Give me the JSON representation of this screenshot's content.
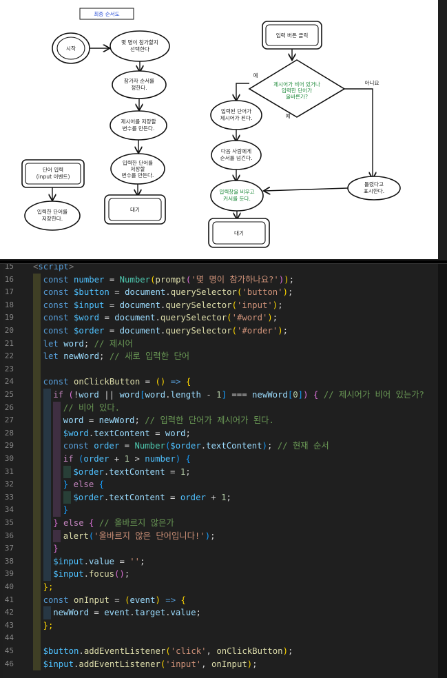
{
  "flowchart": {
    "title": "최종 순서도",
    "left": {
      "start": "시작",
      "n1": [
        "몇 명이 참가할지",
        "선택한다"
      ],
      "n2": [
        "참가자 순서를",
        "정한다."
      ],
      "n3": [
        "제시어를 저장할",
        "변수를 만든다."
      ],
      "n4": [
        "입력한 단어를",
        "저장할",
        "변수를 만든다."
      ],
      "wait": "대기",
      "event": [
        "단어 입력",
        "(input 이벤트)"
      ],
      "store": [
        "입력한 단어를",
        "저장한다."
      ]
    },
    "right": {
      "click": "입력 버튼 클릭",
      "decision": [
        "제시어가 비어 있거나",
        "입력한 단어가",
        "올바른가?"
      ],
      "yes1": "예",
      "yes2": "예",
      "no": "아니요",
      "r1": [
        "입력된 단어가",
        "제시어가 된다."
      ],
      "r2": [
        "다음 사람에게",
        "순서를 넘긴다."
      ],
      "r3": [
        "입력창을 비우고",
        "커서를 둔다."
      ],
      "wrong": [
        "틀렸다고",
        "표시한다."
      ],
      "wait": "대기"
    }
  },
  "editor": {
    "lines": [
      {
        "n": "15",
        "t": [
          [
            "<",
            "#808080"
          ],
          [
            "script",
            "#569cd6"
          ],
          [
            ">",
            "#808080"
          ]
        ],
        "indent": 0
      },
      {
        "n": "16",
        "t": [
          [
            "const ",
            "#569cd6"
          ],
          [
            "number",
            "#4fc1ff"
          ],
          [
            " = ",
            "#d4d4d4"
          ],
          [
            "Number",
            "#4ec9b0"
          ],
          [
            "(",
            "#ffd700"
          ],
          [
            "prompt",
            "#dcdcaa"
          ],
          [
            "(",
            "#da70d6"
          ],
          [
            "'몇 명이 참가하나요?'",
            "#ce9178"
          ],
          [
            ")",
            "#da70d6"
          ],
          [
            ")",
            "#ffd700"
          ],
          [
            ";",
            "#d4d4d4"
          ]
        ],
        "indent": 1
      },
      {
        "n": "17",
        "t": [
          [
            "const ",
            "#569cd6"
          ],
          [
            "$button",
            "#4fc1ff"
          ],
          [
            " = ",
            "#d4d4d4"
          ],
          [
            "document",
            "#9cdcfe"
          ],
          [
            ".",
            "#d4d4d4"
          ],
          [
            "querySelector",
            "#dcdcaa"
          ],
          [
            "(",
            "#ffd700"
          ],
          [
            "'button'",
            "#ce9178"
          ],
          [
            ")",
            "#ffd700"
          ],
          [
            ";",
            "#d4d4d4"
          ]
        ],
        "indent": 1
      },
      {
        "n": "18",
        "t": [
          [
            "const ",
            "#569cd6"
          ],
          [
            "$input",
            "#4fc1ff"
          ],
          [
            " = ",
            "#d4d4d4"
          ],
          [
            "document",
            "#9cdcfe"
          ],
          [
            ".",
            "#d4d4d4"
          ],
          [
            "querySelector",
            "#dcdcaa"
          ],
          [
            "(",
            "#ffd700"
          ],
          [
            "'input'",
            "#ce9178"
          ],
          [
            ")",
            "#ffd700"
          ],
          [
            ";",
            "#d4d4d4"
          ]
        ],
        "indent": 1
      },
      {
        "n": "19",
        "t": [
          [
            "const ",
            "#569cd6"
          ],
          [
            "$word",
            "#4fc1ff"
          ],
          [
            " = ",
            "#d4d4d4"
          ],
          [
            "document",
            "#9cdcfe"
          ],
          [
            ".",
            "#d4d4d4"
          ],
          [
            "querySelector",
            "#dcdcaa"
          ],
          [
            "(",
            "#ffd700"
          ],
          [
            "'#word'",
            "#ce9178"
          ],
          [
            ")",
            "#ffd700"
          ],
          [
            ";",
            "#d4d4d4"
          ]
        ],
        "indent": 1
      },
      {
        "n": "20",
        "t": [
          [
            "const ",
            "#569cd6"
          ],
          [
            "$order",
            "#4fc1ff"
          ],
          [
            " = ",
            "#d4d4d4"
          ],
          [
            "document",
            "#9cdcfe"
          ],
          [
            ".",
            "#d4d4d4"
          ],
          [
            "querySelector",
            "#dcdcaa"
          ],
          [
            "(",
            "#ffd700"
          ],
          [
            "'#order'",
            "#ce9178"
          ],
          [
            ")",
            "#ffd700"
          ],
          [
            ";",
            "#d4d4d4"
          ]
        ],
        "indent": 1
      },
      {
        "n": "21",
        "t": [
          [
            "let ",
            "#569cd6"
          ],
          [
            "word",
            "#9cdcfe"
          ],
          [
            "; ",
            "#d4d4d4"
          ],
          [
            "// 제시어",
            "#6a9955"
          ]
        ],
        "indent": 1
      },
      {
        "n": "22",
        "t": [
          [
            "let ",
            "#569cd6"
          ],
          [
            "newWord",
            "#9cdcfe"
          ],
          [
            "; ",
            "#d4d4d4"
          ],
          [
            "// 새로 입력한 단어",
            "#6a9955"
          ]
        ],
        "indent": 1
      },
      {
        "n": "23",
        "t": [],
        "indent": 1
      },
      {
        "n": "24",
        "t": [
          [
            "const ",
            "#569cd6"
          ],
          [
            "onClickButton",
            "#dcdcaa"
          ],
          [
            " = ",
            "#d4d4d4"
          ],
          [
            "()",
            "#ffd700"
          ],
          [
            " => ",
            "#569cd6"
          ],
          [
            "{",
            "#ffd700"
          ]
        ],
        "indent": 1
      },
      {
        "n": "25",
        "t": [
          [
            "if ",
            "#c586c0"
          ],
          [
            "(",
            "#da70d6"
          ],
          [
            "!",
            "#d4d4d4"
          ],
          [
            "word",
            "#9cdcfe"
          ],
          [
            " || ",
            "#d4d4d4"
          ],
          [
            "word",
            "#9cdcfe"
          ],
          [
            "[",
            "#179fff"
          ],
          [
            "word",
            "#9cdcfe"
          ],
          [
            ".",
            "#d4d4d4"
          ],
          [
            "length",
            "#9cdcfe"
          ],
          [
            " - ",
            "#d4d4d4"
          ],
          [
            "1",
            "#b5cea8"
          ],
          [
            "]",
            "#179fff"
          ],
          [
            " === ",
            "#d4d4d4"
          ],
          [
            "newWord",
            "#9cdcfe"
          ],
          [
            "[",
            "#179fff"
          ],
          [
            "0",
            "#b5cea8"
          ],
          [
            "]",
            "#179fff"
          ],
          [
            ")",
            "#da70d6"
          ],
          [
            " { ",
            "#da70d6"
          ],
          [
            "// 제시어가 비어 있는가?",
            "#6a9955"
          ]
        ],
        "indent": 2
      },
      {
        "n": "26",
        "t": [
          [
            "// 비어 있다.",
            "#6a9955"
          ]
        ],
        "indent": 3
      },
      {
        "n": "27",
        "t": [
          [
            "word",
            "#9cdcfe"
          ],
          [
            " = ",
            "#d4d4d4"
          ],
          [
            "newWord",
            "#9cdcfe"
          ],
          [
            "; ",
            "#d4d4d4"
          ],
          [
            "// 입력한 단어가 제시어가 된다.",
            "#6a9955"
          ]
        ],
        "indent": 3
      },
      {
        "n": "28",
        "t": [
          [
            "$word",
            "#4fc1ff"
          ],
          [
            ".",
            "#d4d4d4"
          ],
          [
            "textContent",
            "#9cdcfe"
          ],
          [
            " = ",
            "#d4d4d4"
          ],
          [
            "word",
            "#9cdcfe"
          ],
          [
            ";",
            "#d4d4d4"
          ]
        ],
        "indent": 3
      },
      {
        "n": "29",
        "t": [
          [
            "const ",
            "#569cd6"
          ],
          [
            "order",
            "#4fc1ff"
          ],
          [
            " = ",
            "#d4d4d4"
          ],
          [
            "Number",
            "#4ec9b0"
          ],
          [
            "(",
            "#179fff"
          ],
          [
            "$order",
            "#4fc1ff"
          ],
          [
            ".",
            "#d4d4d4"
          ],
          [
            "textContent",
            "#9cdcfe"
          ],
          [
            ")",
            "#179fff"
          ],
          [
            "; ",
            "#d4d4d4"
          ],
          [
            "// 현재 순서",
            "#6a9955"
          ]
        ],
        "indent": 3
      },
      {
        "n": "30",
        "t": [
          [
            "if ",
            "#c586c0"
          ],
          [
            "(",
            "#179fff"
          ],
          [
            "order",
            "#4fc1ff"
          ],
          [
            " + ",
            "#d4d4d4"
          ],
          [
            "1",
            "#b5cea8"
          ],
          [
            " > ",
            "#d4d4d4"
          ],
          [
            "number",
            "#4fc1ff"
          ],
          [
            ")",
            "#179fff"
          ],
          [
            " {",
            "#179fff"
          ]
        ],
        "indent": 3
      },
      {
        "n": "31",
        "t": [
          [
            "$order",
            "#4fc1ff"
          ],
          [
            ".",
            "#d4d4d4"
          ],
          [
            "textContent",
            "#9cdcfe"
          ],
          [
            " = ",
            "#d4d4d4"
          ],
          [
            "1",
            "#b5cea8"
          ],
          [
            ";",
            "#d4d4d4"
          ]
        ],
        "indent": 4
      },
      {
        "n": "32",
        "t": [
          [
            "} ",
            "#179fff"
          ],
          [
            "else ",
            "#c586c0"
          ],
          [
            "{",
            "#179fff"
          ]
        ],
        "indent": 3
      },
      {
        "n": "33",
        "t": [
          [
            "$order",
            "#4fc1ff"
          ],
          [
            ".",
            "#d4d4d4"
          ],
          [
            "textContent",
            "#9cdcfe"
          ],
          [
            " = ",
            "#d4d4d4"
          ],
          [
            "order",
            "#4fc1ff"
          ],
          [
            " + ",
            "#d4d4d4"
          ],
          [
            "1",
            "#b5cea8"
          ],
          [
            ";",
            "#d4d4d4"
          ]
        ],
        "indent": 4
      },
      {
        "n": "34",
        "t": [
          [
            "}",
            "#179fff"
          ]
        ],
        "indent": 3
      },
      {
        "n": "35",
        "t": [
          [
            "} ",
            "#da70d6"
          ],
          [
            "else ",
            "#c586c0"
          ],
          [
            "{ ",
            "#da70d6"
          ],
          [
            "// 올바르지 않은가",
            "#6a9955"
          ]
        ],
        "indent": 2
      },
      {
        "n": "36",
        "t": [
          [
            "alert",
            "#dcdcaa"
          ],
          [
            "(",
            "#179fff"
          ],
          [
            "'올바르지 않은 단어입니다!'",
            "#ce9178"
          ],
          [
            ")",
            "#179fff"
          ],
          [
            ";",
            "#d4d4d4"
          ]
        ],
        "indent": 3
      },
      {
        "n": "37",
        "t": [
          [
            "}",
            "#da70d6"
          ]
        ],
        "indent": 2
      },
      {
        "n": "38",
        "t": [
          [
            "$input",
            "#4fc1ff"
          ],
          [
            ".",
            "#d4d4d4"
          ],
          [
            "value",
            "#9cdcfe"
          ],
          [
            " = ",
            "#d4d4d4"
          ],
          [
            "''",
            "#ce9178"
          ],
          [
            ";",
            "#d4d4d4"
          ]
        ],
        "indent": 2
      },
      {
        "n": "39",
        "t": [
          [
            "$input",
            "#4fc1ff"
          ],
          [
            ".",
            "#d4d4d4"
          ],
          [
            "focus",
            "#dcdcaa"
          ],
          [
            "()",
            "#da70d6"
          ],
          [
            ";",
            "#d4d4d4"
          ]
        ],
        "indent": 2
      },
      {
        "n": "40",
        "t": [
          [
            "};",
            "#ffd700"
          ]
        ],
        "indent": 1
      },
      {
        "n": "41",
        "t": [
          [
            "const ",
            "#569cd6"
          ],
          [
            "onInput",
            "#dcdcaa"
          ],
          [
            " = ",
            "#d4d4d4"
          ],
          [
            "(",
            "#ffd700"
          ],
          [
            "event",
            "#9cdcfe"
          ],
          [
            ")",
            "#ffd700"
          ],
          [
            " => ",
            "#569cd6"
          ],
          [
            "{",
            "#ffd700"
          ]
        ],
        "indent": 1
      },
      {
        "n": "42",
        "t": [
          [
            "newWord",
            "#9cdcfe"
          ],
          [
            " = ",
            "#d4d4d4"
          ],
          [
            "event",
            "#9cdcfe"
          ],
          [
            ".",
            "#d4d4d4"
          ],
          [
            "target",
            "#9cdcfe"
          ],
          [
            ".",
            "#d4d4d4"
          ],
          [
            "value",
            "#9cdcfe"
          ],
          [
            ";",
            "#d4d4d4"
          ]
        ],
        "indent": 2
      },
      {
        "n": "43",
        "t": [
          [
            "};",
            "#ffd700"
          ]
        ],
        "indent": 1
      },
      {
        "n": "44",
        "t": [],
        "indent": 1
      },
      {
        "n": "45",
        "t": [
          [
            "$button",
            "#4fc1ff"
          ],
          [
            ".",
            "#d4d4d4"
          ],
          [
            "addEventListener",
            "#dcdcaa"
          ],
          [
            "(",
            "#ffd700"
          ],
          [
            "'click'",
            "#ce9178"
          ],
          [
            ", ",
            "#d4d4d4"
          ],
          [
            "onClickButton",
            "#dcdcaa"
          ],
          [
            ")",
            "#ffd700"
          ],
          [
            ";",
            "#d4d4d4"
          ]
        ],
        "indent": 1
      },
      {
        "n": "46",
        "t": [
          [
            "$input",
            "#4fc1ff"
          ],
          [
            ".",
            "#d4d4d4"
          ],
          [
            "addEventListener",
            "#dcdcaa"
          ],
          [
            "(",
            "#ffd700"
          ],
          [
            "'input'",
            "#ce9178"
          ],
          [
            ", ",
            "#d4d4d4"
          ],
          [
            "onInput",
            "#dcdcaa"
          ],
          [
            ")",
            "#ffd700"
          ],
          [
            ";",
            "#d4d4d4"
          ]
        ],
        "indent": 1
      }
    ]
  }
}
